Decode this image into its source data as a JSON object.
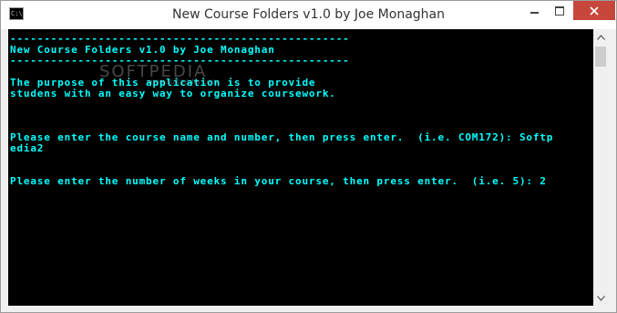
{
  "window": {
    "title": "New Course Folders v1.0 by Joe Monaghan",
    "icon_name": "console-icon",
    "icon_text": "C:\\."
  },
  "controls": {
    "minimize_icon": "minimize-icon",
    "maximize_icon": "maximize-icon",
    "close_icon": "close-icon"
  },
  "console": {
    "lines": [
      "--------------------------------------------------",
      "New Course Folders v1.0 by Joe Monaghan",
      "--------------------------------------------------",
      "",
      "The purpose of this application is to provide",
      "studens with an easy way to organize coursework.",
      "",
      "",
      "",
      "Please enter the course name and number, then press enter.  (i.e. COM172): Softp",
      "edia2",
      "",
      "",
      "Please enter the number of weeks in your course, then press enter.  (i.e. 5): 2"
    ],
    "text_color": "#00ffff",
    "background": "#000000"
  },
  "watermark": {
    "text": "SOFTPEDIA",
    "url_text": "www.softpedia.com"
  }
}
